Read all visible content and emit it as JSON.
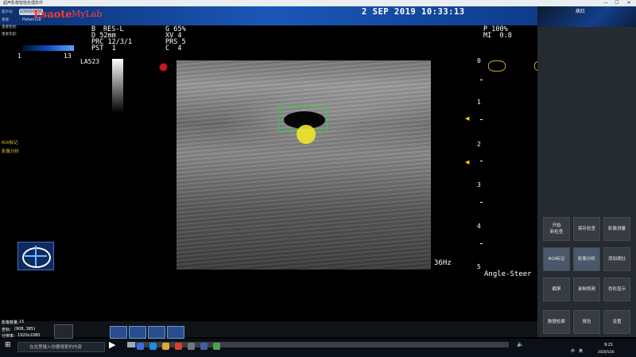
{
  "window": {
    "title": "超声影像智能处理软件",
    "controls": [
      "—",
      "☐",
      "✕"
    ]
  },
  "header": {
    "logo": "Esaote",
    "logo_product": "MyLab",
    "patient_id_label": "超声号:",
    "patient_id": "100000001",
    "patient_name_label": "患者:",
    "patient_name": "Patient18",
    "row_labels": [
      "患者性别:",
      "患者年龄:"
    ],
    "datetime": "2 SEP 2019 10:33:13",
    "case_button": "病灶"
  },
  "params_left": {
    "probe_mode": "B",
    "rows": [
      "RES-L",
      "D 52mm",
      "PRC 12/3/1",
      "PST  1"
    ],
    "scale_left": "1",
    "scale_right": "13",
    "probe_name": "LA523"
  },
  "params_mid": {
    "rows": [
      "G 65%",
      "XV 4",
      "PRS 5",
      "C  4"
    ]
  },
  "params_right": {
    "rows": [
      "P 100%",
      "MI  0.8"
    ]
  },
  "depth_scale": {
    "labels": [
      "0",
      "1",
      "2",
      "3",
      "4",
      "5"
    ]
  },
  "frequency": "36Hz",
  "angle_label": "Angle-Steer",
  "side_labels": {
    "roi": "ROI标记",
    "analysis": "影像分析"
  },
  "bottom_info": {
    "image_count_label": "影像数量:",
    "image_count": "15",
    "coord_label": "坐标:",
    "coord": "(908, 385)",
    "resolution_label": "分辨率:",
    "resolution": "1920x1080"
  },
  "panel_buttons": [
    {
      "label": "开始\n新检查"
    },
    {
      "label": "保存检查"
    },
    {
      "label": "影像测量"
    },
    {
      "label": "ROI标记",
      "active": true
    },
    {
      "label": "影像分析",
      "active": true
    },
    {
      "label": "添加病灶"
    },
    {
      "label": "截屏"
    },
    {
      "label": "录制视频"
    },
    {
      "label": "伪彩显示"
    },
    {
      "label": "数据检索"
    },
    {
      "label": "报告"
    },
    {
      "label": "设置"
    }
  ],
  "taskbar": {
    "search_placeholder": "在这里输入你要搜索的内容",
    "clock_time": "9:21",
    "clock_date": "2020/5/26",
    "ime": "中",
    "locale": "英"
  },
  "colors": {
    "roi_box": "#2bd62b",
    "cursor": "#f0e628",
    "focus_marker": "#f0d000",
    "logo": "#ff3a3a"
  }
}
